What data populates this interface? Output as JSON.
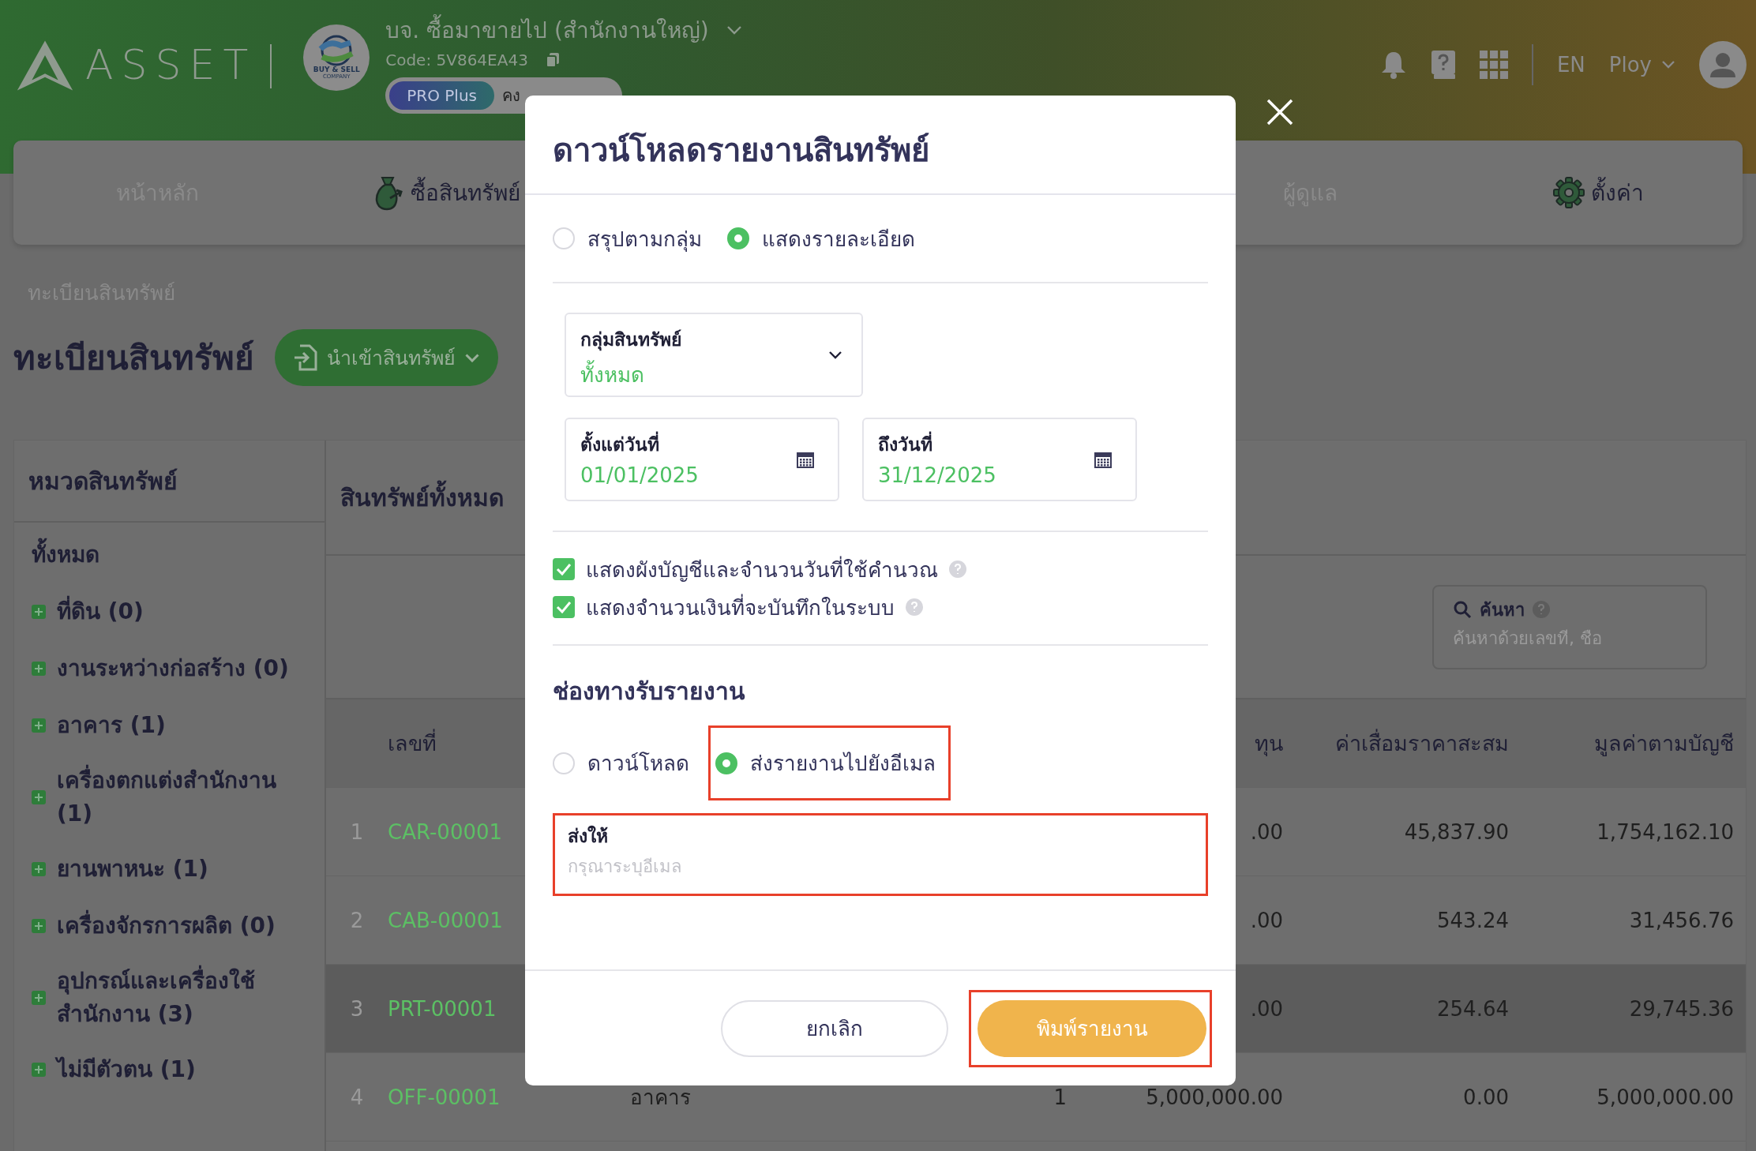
{
  "header": {
    "logo_text": "ASSET",
    "company_logo": {
      "line1": "BUY & SELL",
      "line2": "COMPANY"
    },
    "company_name": "บจ. ซื้อมาขายไป (สำนักงานใหญ่)",
    "company_code": "Code: 5V864EA43",
    "plan_badge": "PRO Plus",
    "plan_remaining": "คง",
    "language": "EN",
    "user_name": "Ploy"
  },
  "nav": [
    {
      "label": "หน้าหลัก",
      "kind": "plain"
    },
    {
      "label": "ซื้อสินทรัพย์",
      "kind": "bag"
    },
    {
      "label": "ผู้ดูแล",
      "kind": "plain"
    },
    {
      "label": "ตั้งค่า",
      "kind": "gear"
    }
  ],
  "breadcrumb": "ทะเบียนสินทรัพย์",
  "page_title": "ทะเบียนสินทรัพย์",
  "import_button": "นำเข้าสินทรัพย์",
  "sidebar": {
    "title": "หมวดสินทรัพย์",
    "items": [
      {
        "label": "ทั้งหมด",
        "expandable": false
      },
      {
        "label": "ที่ดิน (0)",
        "expandable": true
      },
      {
        "label": "งานระหว่างก่อสร้าง (0)",
        "expandable": true
      },
      {
        "label": "อาคาร (1)",
        "expandable": true
      },
      {
        "label": "เครื่องตกแต่งสำนักงาน (1)",
        "expandable": true
      },
      {
        "label": "ยานพาหนะ (1)",
        "expandable": true
      },
      {
        "label": "เครื่องจักรการผลิต (0)",
        "expandable": true
      },
      {
        "label": "อุปกรณ์และเครื่องใช้สำนักงาน (3)",
        "expandable": true
      },
      {
        "label": "ไม่มีตัวตน (1)",
        "expandable": true
      }
    ]
  },
  "main": {
    "title": "สินทรัพย์ทั้งหมด",
    "search": {
      "label": "ค้นหา",
      "placeholder": "ค้นหาด้วยเลขที่, ชื่อ"
    },
    "table": {
      "columns": [
        {
          "label": "เลขที่"
        },
        {
          "label": "ทุน"
        },
        {
          "label": "ค่าเสื่อมราคาสะสม"
        },
        {
          "label": "มูลค่าตามบัญชี"
        }
      ],
      "rows": [
        {
          "index": "1",
          "code": "CAR-00001",
          "cost": ".00",
          "depreciation": "45,837.90",
          "book_value": "1,754,162.10",
          "highlighted": false
        },
        {
          "index": "2",
          "code": "CAB-00001",
          "cost": ".00",
          "depreciation": "543.24",
          "book_value": "31,456.76",
          "highlighted": false
        },
        {
          "index": "3",
          "code": "PRT-00001",
          "cost": ".00",
          "depreciation": "254.64",
          "book_value": "29,745.36",
          "highlighted": true
        },
        {
          "index": "4",
          "code": "OFF-00001",
          "category": "อาคาร",
          "quantity": "1",
          "cost": "5,000,000.00",
          "depreciation": "0.00",
          "book_value": "5,000,000.00",
          "highlighted": false
        }
      ]
    }
  },
  "modal": {
    "title": "ดาวน์โหลดรายงานสินทรัพย์",
    "report_types": [
      {
        "label": "สรุปตามกลุ่ม",
        "selected": false
      },
      {
        "label": "แสดงรายละเอียด",
        "selected": true
      }
    ],
    "group_select": {
      "label": "กลุ่มสินทรัพย์",
      "value": "ทั้งหมด"
    },
    "date_from": {
      "label": "ตั้งแต่วันที่",
      "value": "01/01/2025"
    },
    "date_to": {
      "label": "ถึงวันที่",
      "value": "31/12/2025"
    },
    "options": [
      {
        "label": "แสดงผังบัญชีและจำนวนวันที่ใช้คำนวณ",
        "checked": true
      },
      {
        "label": "แสดงจำนวนเงินที่จะบันทึกในระบบ",
        "checked": true
      }
    ],
    "channel_title": "ช่องทางรับรายงาน",
    "channels": [
      {
        "label": "ดาวน์โหลด",
        "selected": false,
        "marked": false
      },
      {
        "label": "ส่งรายงานไปยังอีเมล",
        "selected": true,
        "marked": true
      }
    ],
    "recipient": {
      "label": "ส่งให้",
      "placeholder": "กรุณาระบุอีเมล",
      "marked": true
    },
    "cancel_button": "ยกเลิก",
    "print_button": {
      "label": "พิมพ์รายงาน",
      "marked": true
    }
  }
}
